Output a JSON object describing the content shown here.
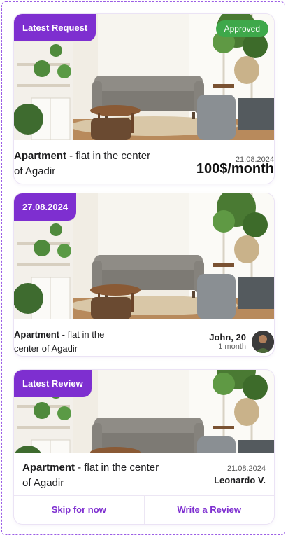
{
  "cards": [
    {
      "tag": "Latest Request",
      "status": "Approved",
      "title_bold": "Apartment",
      "title_rest": " - flat in the center of Agadir",
      "date": "21.08.2024",
      "price": "100$/month"
    },
    {
      "tag": "27.08.2024",
      "title_bold": "Apartment",
      "title_rest": " - flat in the center of Agadir",
      "person": "John, 20",
      "duration": "1 month"
    },
    {
      "tag": "Latest Review",
      "title_bold": "Apartment",
      "title_rest": " - flat in the center of Agadir",
      "date": "21.08.2024",
      "person": "Leonardo V.",
      "actions": {
        "skip": "Skip for now",
        "write": "Write a Review"
      }
    }
  ],
  "colors": {
    "accent": "#7e2fd0",
    "approved": "#3ea84a"
  }
}
